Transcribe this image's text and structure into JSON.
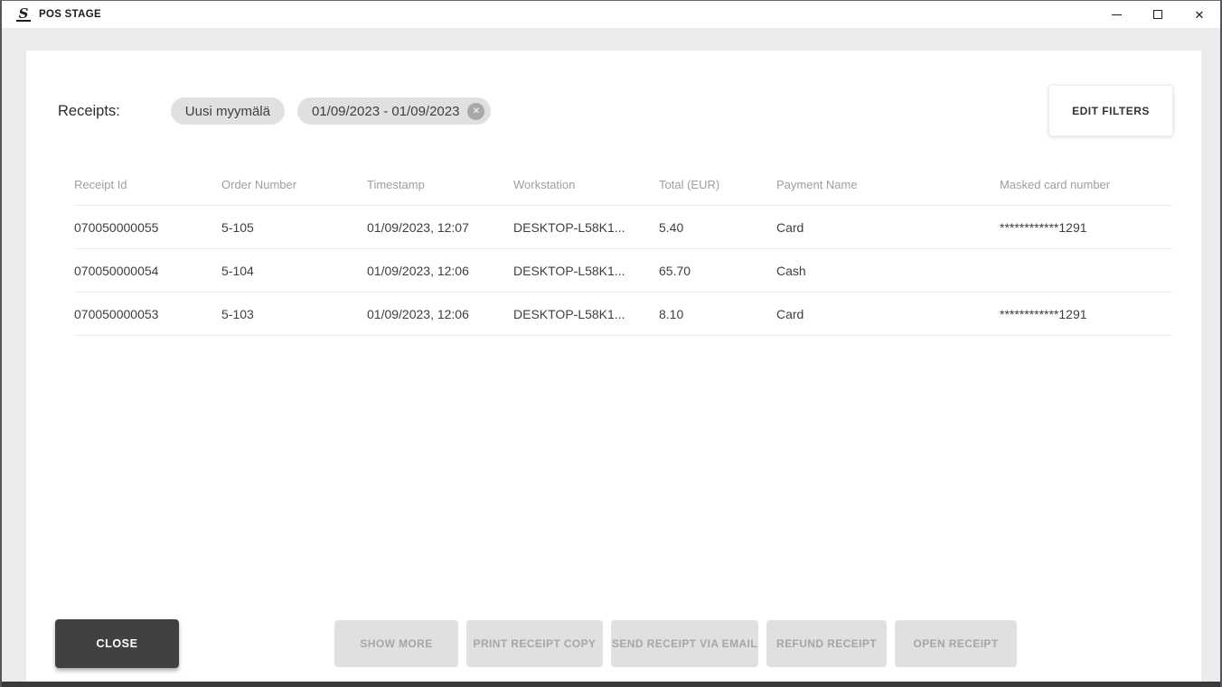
{
  "window": {
    "title": "POS STAGE",
    "logo_glyph": "S"
  },
  "filters": {
    "label": "Receipts:",
    "chips": [
      {
        "label": "Uusi myymälä",
        "removable": false
      },
      {
        "label": "01/09/2023 - 01/09/2023",
        "removable": true
      }
    ],
    "remove_icon": "✕",
    "edit_button": "EDIT FILTERS"
  },
  "table": {
    "columns": [
      "Receipt Id",
      "Order Number",
      "Timestamp",
      "Workstation",
      "Total (EUR)",
      "Payment Name",
      "Masked card number"
    ],
    "rows": [
      [
        "070050000055",
        "5-105",
        "01/09/2023, 12:07",
        "DESKTOP-L58K1...",
        "5.40",
        "Card",
        "************1291"
      ],
      [
        "070050000054",
        "5-104",
        "01/09/2023, 12:06",
        "DESKTOP-L58K1...",
        "65.70",
        "Cash",
        ""
      ],
      [
        "070050000053",
        "5-103",
        "01/09/2023, 12:06",
        "DESKTOP-L58K1...",
        "8.10",
        "Card",
        "************1291"
      ]
    ]
  },
  "actions": {
    "close_label": "CLOSE",
    "disabled": [
      "SHOW MORE",
      "PRINT RECEIPT COPY",
      "SEND RECEIPT VIA EMAIL",
      "REFUND RECEIPT",
      "OPEN RECEIPT"
    ]
  },
  "colors": {
    "window_bg": "#ebebeb",
    "card_bg": "#ffffff",
    "chip_bg": "#e0e0e0",
    "close_button_bg": "#414144",
    "disabled_button_bg": "#e0e0e0",
    "disabled_button_text": "#a6a6a6",
    "header_text": "#9e9e9e",
    "cell_text": "#3e3e3e",
    "bottom_strip": "#3a3a3c"
  }
}
